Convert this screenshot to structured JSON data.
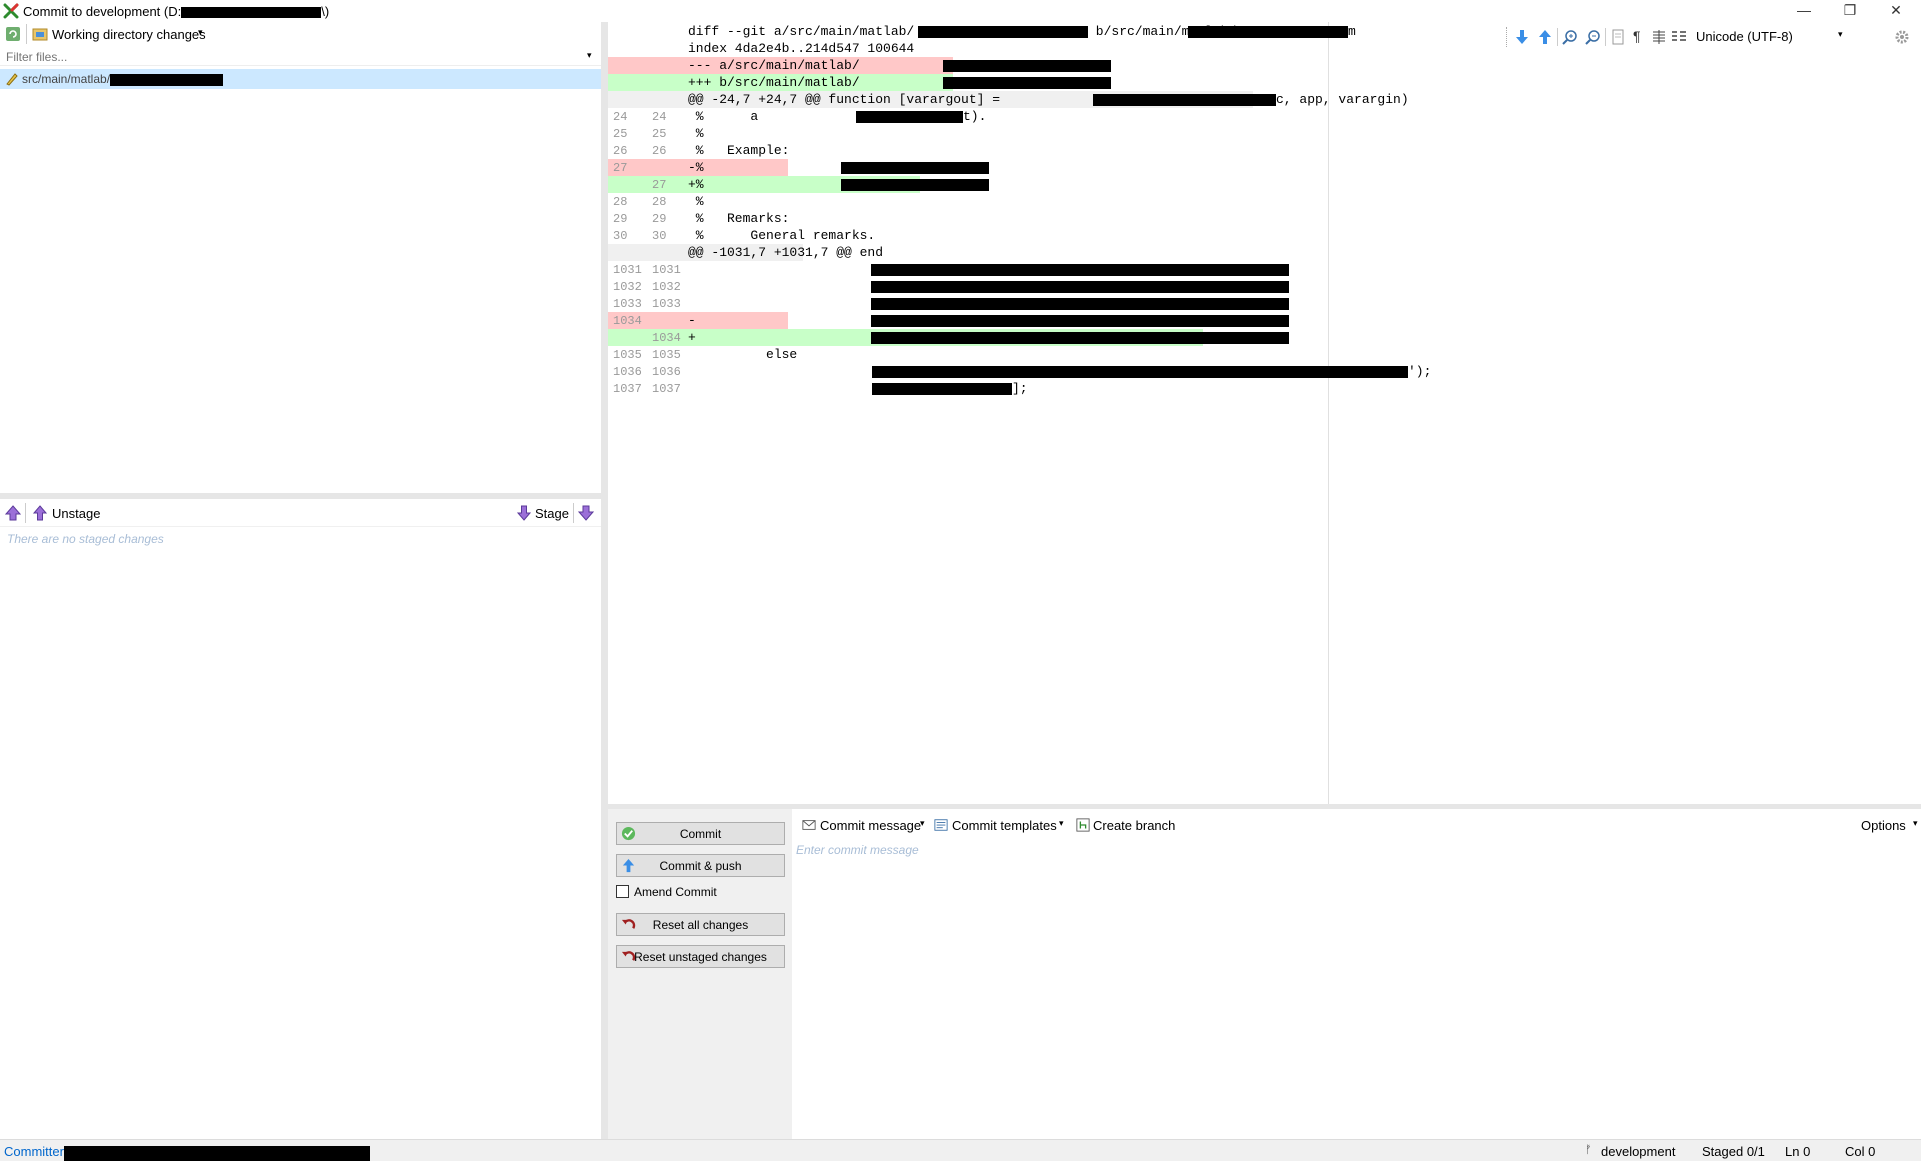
{
  "window": {
    "title": "Commit to development (D:",
    "title_suffix": "\\)",
    "minimize": "—",
    "restore": "❐",
    "close": "✕"
  },
  "left_top": {
    "mode_label": "Working directory changes",
    "filter_placeholder": "Filter files...",
    "files": [
      {
        "path": "src/main/matlab/"
      }
    ]
  },
  "left_bottom": {
    "unstage_label": "Unstage",
    "stage_label": "Stage",
    "empty_message": "There are no staged changes"
  },
  "diff": {
    "encoding": "Unicode (UTF-8)",
    "lines": [
      {
        "old": "",
        "new": "",
        "type": "header",
        "text": "diff --git a/src/main/matlab/"
      },
      {
        "old": "",
        "new": "",
        "type": "header",
        "text": "index 4da2e4b..214d547 100644"
      },
      {
        "old": "",
        "new": "",
        "type": "header-del",
        "text": "--- a/src/main/matlab/"
      },
      {
        "old": "",
        "new": "",
        "type": "header-add",
        "text": "+++ b/src/main/matlab/"
      },
      {
        "old": "",
        "new": "",
        "type": "hunk",
        "text": "@@ -24,7 +24,7 @@ function [varargout] = "
      },
      {
        "old": "24",
        "new": "24",
        "type": "ctx",
        "text": " %      a "
      },
      {
        "old": "25",
        "new": "25",
        "type": "ctx",
        "text": " %"
      },
      {
        "old": "26",
        "new": "26",
        "type": "ctx",
        "text": " %   Example:"
      },
      {
        "old": "27",
        "new": "",
        "type": "del",
        "text": "-%"
      },
      {
        "old": "",
        "new": "27",
        "type": "add",
        "text": "+%"
      },
      {
        "old": "28",
        "new": "28",
        "type": "ctx",
        "text": " %"
      },
      {
        "old": "29",
        "new": "29",
        "type": "ctx",
        "text": " %   Remarks:"
      },
      {
        "old": "30",
        "new": "30",
        "type": "ctx",
        "text": " %      General remarks."
      },
      {
        "old": "",
        "new": "",
        "type": "hunk",
        "text": "@@ -1031,7 +1031,7 @@ end"
      },
      {
        "old": "1031",
        "new": "1031",
        "type": "ctx",
        "text": ""
      },
      {
        "old": "1032",
        "new": "1032",
        "type": "ctx",
        "text": ""
      },
      {
        "old": "1033",
        "new": "1033",
        "type": "ctx",
        "text": ""
      },
      {
        "old": "1034",
        "new": "",
        "type": "del",
        "text": "-"
      },
      {
        "old": "",
        "new": "1034",
        "type": "add",
        "text": "+"
      },
      {
        "old": "1035",
        "new": "1035",
        "type": "ctx",
        "text": "          else"
      },
      {
        "old": "1036",
        "new": "1036",
        "type": "ctx",
        "text": ""
      },
      {
        "old": "1037",
        "new": "1037",
        "type": "ctx",
        "text": ""
      }
    ],
    "fragments": {
      "hdr1_b": " b/src/main/matlab/",
      "hdr1_end": "m",
      "hunk1_tail": "c, app, varargin)",
      "l24_tail": "t).",
      "l36_tail": "');",
      "l37_tail": "];"
    }
  },
  "commit": {
    "commit_label": "Commit",
    "commit_push_label": "Commit & push",
    "amend_label": "Amend Commit",
    "reset_all_label": "Reset all changes",
    "reset_unstaged_label": "Reset unstaged changes",
    "message_menu": "Commit message",
    "templates_menu": "Commit templates",
    "create_branch": "Create branch",
    "options": "Options",
    "message_placeholder": "Enter commit message"
  },
  "status": {
    "committer_label": "Committer",
    "branch": "development",
    "staged": "Staged 0/1",
    "ln": "Ln 0",
    "col": "Col 0"
  },
  "colors": {
    "selection": "#cce8ff",
    "del_bg": "#ffc8c8",
    "add_bg": "#c8ffc8",
    "hunk_bg": "#f0f0f0",
    "accent_link": "#0066cc"
  }
}
